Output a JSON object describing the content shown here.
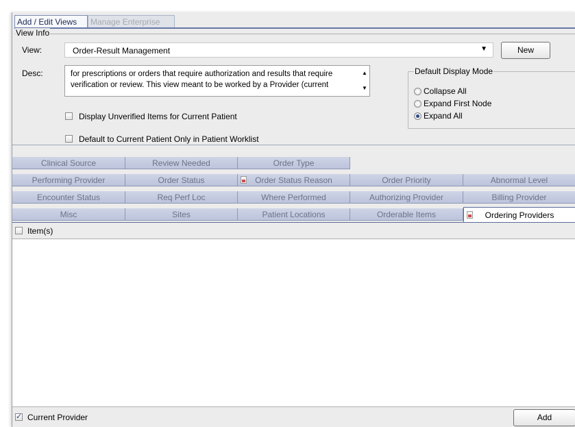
{
  "tabs": {
    "add_edit": "Add / Edit Views",
    "manage_enterprise": "Manage Enterprise"
  },
  "view_info": {
    "legend": "View Info",
    "view_label": "View:",
    "view_value": "Order-Result Management",
    "new_button": "New",
    "desc_label": "Desc:",
    "desc_line1": "for prescriptions or orders that require authorization and results that require",
    "desc_line2": "verification or review.  This view meant to be worked by a Provider (current",
    "display_unverified_label": "Display Unverified Items for Current Patient",
    "display_unverified_checked": false,
    "default_current_patient_label": "Default to Current Patient Only in Patient Worklist",
    "default_current_patient_checked": false
  },
  "display_mode": {
    "legend": "Default Display Mode",
    "options": [
      "Collapse All",
      "Expand First Node",
      "Expand All"
    ],
    "selected": "Expand All"
  },
  "filter_tabs": {
    "row1": [
      "Clinical Source",
      "Review Needed",
      "Order Type"
    ],
    "row2": [
      "Performing Provider",
      "Order Status",
      "Order Status Reason",
      "Order Priority",
      "Abnormal Level"
    ],
    "row3": [
      "Encounter Status",
      "Req Perf Loc",
      "Where Performed",
      "Authorizing Provider",
      "Billing Provider"
    ],
    "row4": [
      "Misc",
      "Sites",
      "Patient Locations",
      "Orderable Items",
      "Ordering Providers"
    ],
    "active": "Ordering Providers",
    "icon_tabs": [
      "Order Status Reason",
      "Ordering Providers"
    ]
  },
  "items": {
    "header_label": "Item(s)",
    "header_checked": false,
    "rows": []
  },
  "footer": {
    "current_provider_label": "Current Provider",
    "current_provider_checked": true,
    "add_button": "Add"
  },
  "colors": {
    "panel_bg": "#ececec",
    "tab_bg": "#c5cce0",
    "tab_text": "#6c7288",
    "accent": "#5b6b9a"
  }
}
